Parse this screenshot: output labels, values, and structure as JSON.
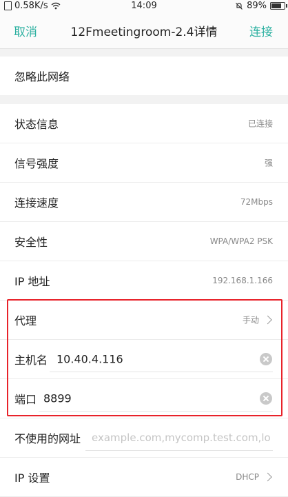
{
  "status_bar": {
    "network_speed": "0.58K/s",
    "time": "14:09",
    "battery": "89%",
    "battery_level": 0.89
  },
  "navbar": {
    "cancel_label": "取消",
    "title": "12Fmeetingroom-2.4详情",
    "connect_label": "连接"
  },
  "forget": {
    "label": "忽略此网络"
  },
  "info": {
    "status": {
      "label": "状态信息",
      "value": "已连接"
    },
    "signal": {
      "label": "信号强度",
      "value": "强"
    },
    "speed": {
      "label": "连接速度",
      "value": "72Mbps"
    },
    "security": {
      "label": "安全性",
      "value": "WPA/WPA2 PSK"
    },
    "ip": {
      "label": "IP 地址",
      "value": "192.168.1.166"
    },
    "proxy": {
      "label": "代理",
      "value": "手动"
    },
    "hostname": {
      "label": "主机名",
      "value": "10.40.4.116"
    },
    "port": {
      "label": "端口",
      "value": "8899"
    },
    "bypass": {
      "label": "不使用的网址",
      "placeholder": "example.com,mycomp.test.com,lo"
    },
    "ip_settings": {
      "label": "IP 设置",
      "value": "DHCP"
    }
  },
  "colors": {
    "accent": "#2bb0a0",
    "highlight": "#e8222a"
  }
}
